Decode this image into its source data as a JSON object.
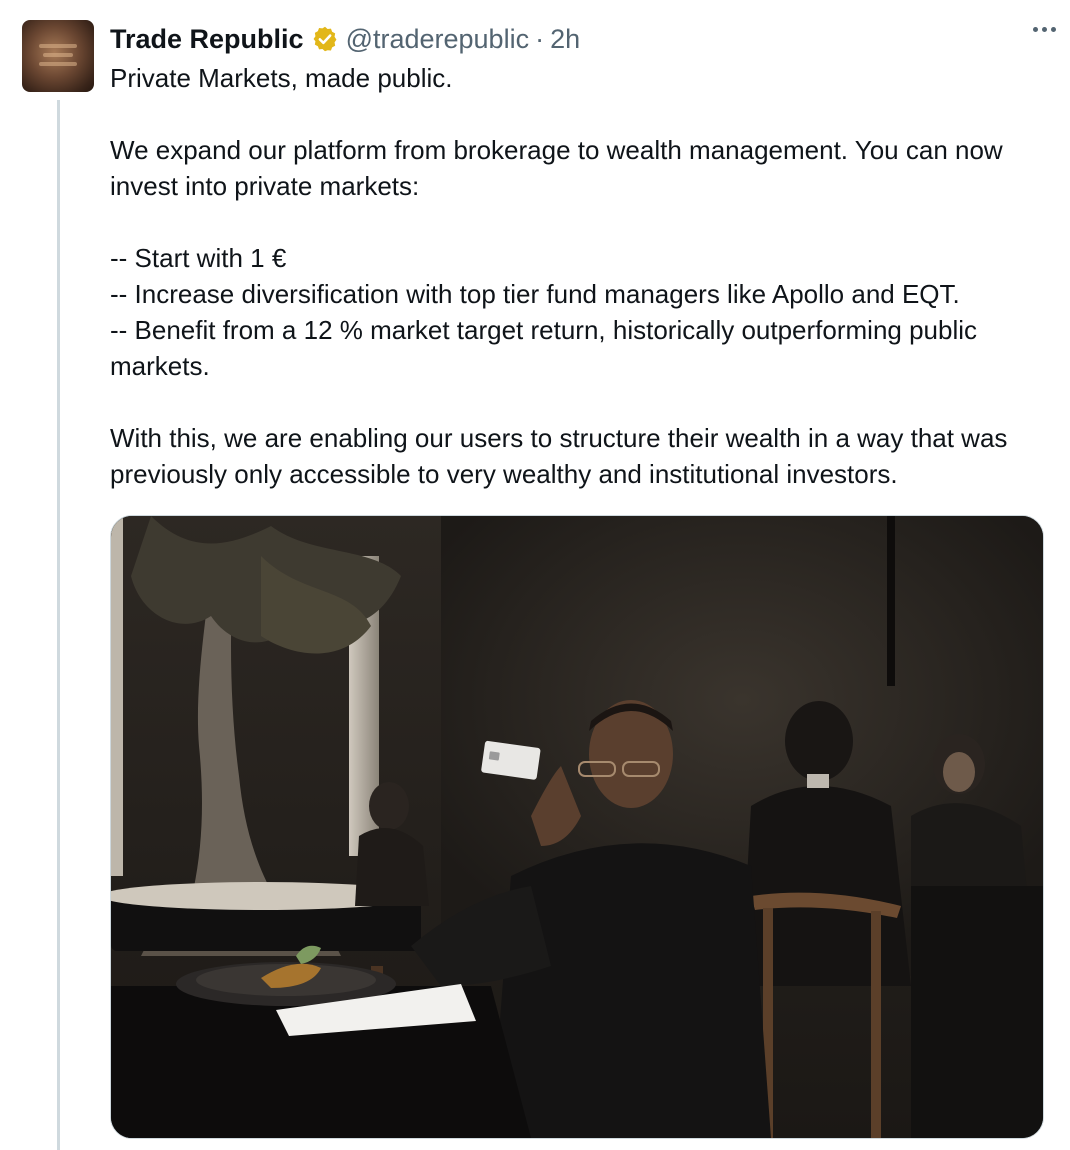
{
  "tweet": {
    "author_name": "Trade Republic",
    "handle": "@traderepublic",
    "separator": "·",
    "time": "2h",
    "verified_icon": "verified-gold-badge-icon",
    "more_icon": "more-options-icon",
    "text": {
      "line1": "Private Markets, made public.",
      "para2": "We expand our platform from brokerage to wealth management. You can now invest into private markets:",
      "bullet1": "-- Start with 1 €",
      "bullet2": "-- Increase diversification with top tier fund managers like Apollo and EQT.",
      "bullet3": "-- Benefit from a 12 % market target return, historically outperforming public markets.",
      "para4": "With this, we are enabling our users to structure their wealth in a way that was previously only accessible to very wealthy and institutional investors."
    }
  },
  "colors": {
    "handle_gray": "#536471",
    "verified_gold": "#e2b719",
    "thread_line": "#cfd9de"
  }
}
